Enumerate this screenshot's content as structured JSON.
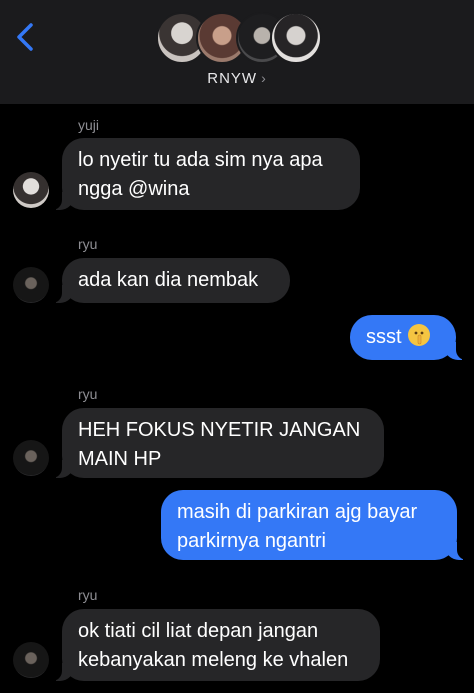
{
  "header": {
    "group_name": "RNYW",
    "chevron": "›",
    "back_icon": "chevron-left-icon"
  },
  "messages": [
    {
      "sender": "yuji",
      "text_lines": [
        "lo nyetir tu ada sim nya apa",
        "ngga @wina"
      ],
      "direction": "incoming"
    },
    {
      "sender": "ryu",
      "text_lines": [
        "ada kan dia nembak"
      ],
      "direction": "incoming"
    },
    {
      "sender": "",
      "text_lines": [
        "ssst"
      ],
      "emoji": "shushing-face-icon",
      "direction": "outgoing"
    },
    {
      "sender": "ryu",
      "text_lines": [
        "HEH FOKUS NYETIR JANGAN",
        "MAIN HP"
      ],
      "direction": "incoming"
    },
    {
      "sender": "",
      "text_lines": [
        "masih di parkiran ajg bayar",
        "parkirnya ngantri"
      ],
      "direction": "outgoing"
    },
    {
      "sender": "ryu",
      "text_lines": [
        "ok tiati cil liat depan jangan",
        "kebanyakan meleng ke vhalen"
      ],
      "direction": "incoming"
    }
  ],
  "colors": {
    "background": "#000000",
    "header": "#1b1b1d",
    "incoming_bubble": "#262628",
    "outgoing_bubble": "#3478f6",
    "accent": "#3478f6"
  }
}
